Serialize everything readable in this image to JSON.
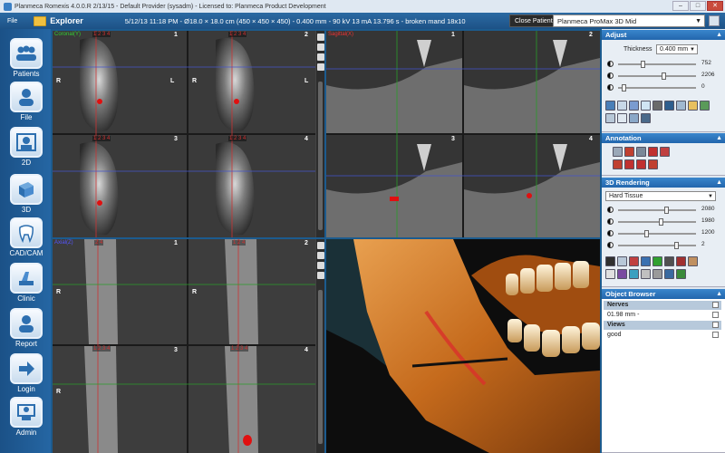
{
  "window": {
    "title": "Planmeca Romexis 4.0.0.R  2/13/15 - Default Provider (sysadm) - Licensed to: Planmeca Product Development",
    "minimize": "–",
    "maximize": "□",
    "close": "✕"
  },
  "menubar": {
    "file": "File",
    "explorer": "Explorer",
    "study_info": "5/12/13 11:18 PM - Ø18.0 × 18.0 cm (450 × 450 × 450) - 0.400 mm - 90 kV 13 mA 13.796 s - broken mand 18x10",
    "close_patient": "Close Patient",
    "device": "Planmeca ProMax 3D Mid"
  },
  "sidebar": {
    "items": [
      {
        "label": "Patients",
        "icon": "patients-icon"
      },
      {
        "label": "File",
        "icon": "file-icon"
      },
      {
        "label": "2D",
        "icon": "2d-icon"
      },
      {
        "label": "3D",
        "icon": "3d-icon"
      },
      {
        "label": "CAD/CAM",
        "icon": "tooth-icon"
      },
      {
        "label": "Clinic",
        "icon": "clinic-icon"
      },
      {
        "label": "Report",
        "icon": "report-icon"
      },
      {
        "label": "Login",
        "icon": "login-icon"
      },
      {
        "label": "Admin",
        "icon": "admin-icon"
      }
    ]
  },
  "views": {
    "coronal": {
      "name": "Coronal(Y)",
      "tiles": [
        "1",
        "2",
        "3",
        "4"
      ],
      "slice_labels": [
        "1 2 3 4",
        "1 2 3 4",
        "1 2 3 4",
        "1 2 3 4"
      ]
    },
    "sagittal": {
      "name": "Sagittal(X)",
      "tiles": [
        "1",
        "2",
        "3",
        "4"
      ]
    },
    "axial": {
      "name": "Axial(Z)",
      "tiles": [
        "1",
        "2",
        "3",
        "4"
      ],
      "slice_labels": [
        "2 4",
        "1 2 4",
        "1 2 3 4",
        "1 2 3 4"
      ]
    },
    "orient_r": "R",
    "orient_l": "L"
  },
  "adjust": {
    "title": "Adjust",
    "thickness_label": "Thickness",
    "thickness_value": "0.400 mm",
    "sliders": [
      {
        "value": "752",
        "level": 0.3
      },
      {
        "value": "2206",
        "level": 0.58
      },
      {
        "value": "0",
        "level": 0.05
      }
    ]
  },
  "annotation": {
    "title": "Annotation"
  },
  "rendering": {
    "title": "3D Rendering",
    "mode": "Hard Tissue",
    "sliders": [
      {
        "value": "2080",
        "level": 0.62
      },
      {
        "value": "1980",
        "level": 0.55
      },
      {
        "value": "1200",
        "level": 0.35
      },
      {
        "value": "2",
        "level": 0.75
      }
    ]
  },
  "object_browser": {
    "title": "Object Browser",
    "rows": [
      {
        "label": "Nerves",
        "group": true
      },
      {
        "label": "01.98 mm -",
        "group": false
      },
      {
        "label": "Views",
        "group": true
      },
      {
        "label": "good",
        "group": false
      }
    ]
  }
}
